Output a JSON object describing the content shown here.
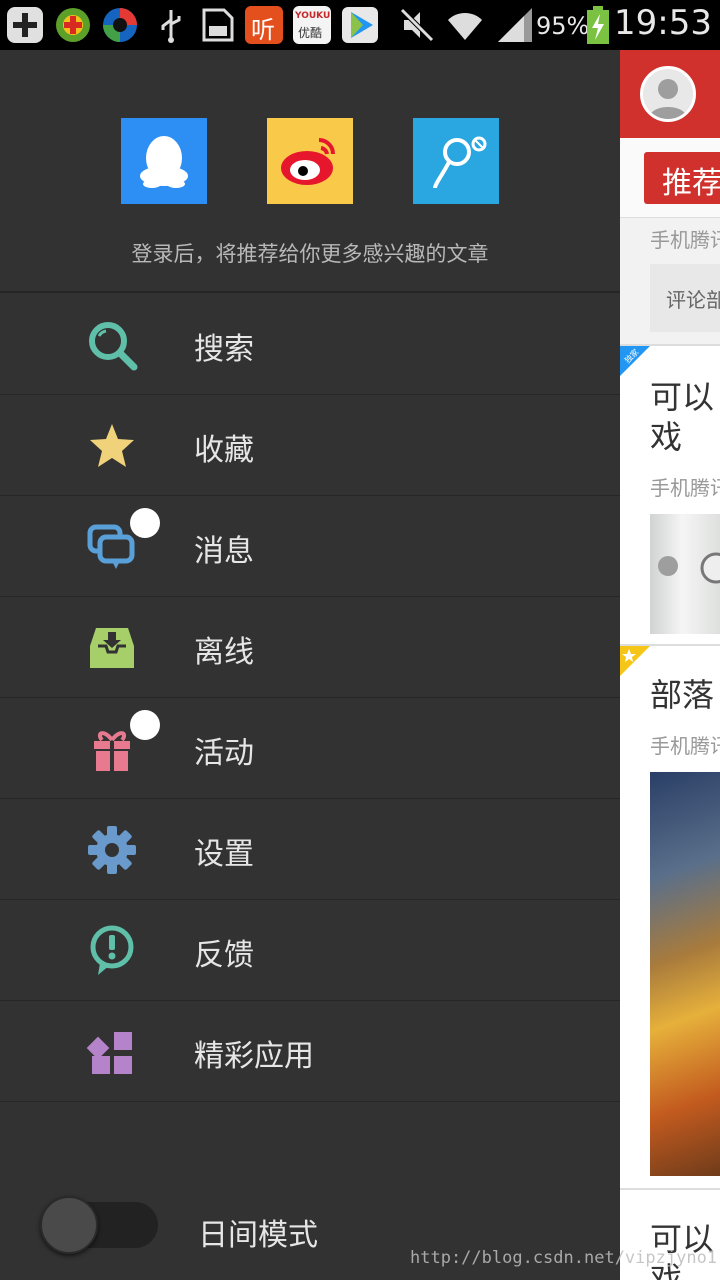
{
  "status_bar": {
    "battery_percent": "95%",
    "time": "19:53",
    "icons": [
      "add-icon",
      "app-icon",
      "app-icon",
      "usb-icon",
      "sd-card-icon",
      "ting-app-icon",
      "youku-app-icon",
      "video-app-icon",
      "mute-icon",
      "wifi-icon",
      "signal-icon",
      "battery-icon"
    ],
    "app_icon_texts": {
      "ting": "听",
      "youku": "YOUKU",
      "youku_cn": "优酷"
    }
  },
  "drawer": {
    "login_hint": "登录后，将推荐给你更多感兴趣的文章",
    "social_logins": [
      {
        "name": "qq-login",
        "color": "#2d8ef4"
      },
      {
        "name": "weibo-login",
        "color": "#f9c949"
      },
      {
        "name": "tencent-weibo-login",
        "color": "#2aa6e0"
      }
    ],
    "menu": [
      {
        "label": "搜索",
        "icon": "search-icon",
        "color": "#5fbfa8",
        "badge": false
      },
      {
        "label": "收藏",
        "icon": "star-icon",
        "color": "#f0d27a",
        "badge": false
      },
      {
        "label": "消息",
        "icon": "message-icon",
        "color": "#5aa0d8",
        "badge": true
      },
      {
        "label": "离线",
        "icon": "offline-download-icon",
        "color": "#a6cf6a",
        "badge": false
      },
      {
        "label": "活动",
        "icon": "gift-icon",
        "color": "#e87a90",
        "badge": true
      },
      {
        "label": "设置",
        "icon": "gear-icon",
        "color": "#6a9acb",
        "badge": false
      },
      {
        "label": "反馈",
        "icon": "feedback-icon",
        "color": "#5fbfa8",
        "badge": false
      },
      {
        "label": "精彩应用",
        "icon": "apps-icon",
        "color": "#b483c9",
        "badge": false
      }
    ],
    "day_mode": {
      "label": "日间模式",
      "enabled": false
    }
  },
  "content": {
    "tab": "推荐",
    "source_1": "手机腾讯",
    "comment": "评论部",
    "article_1_title_line1": "可以",
    "article_1_title_line2": "戏",
    "article_1_tag": "独家",
    "source_2": "手机腾讯",
    "article_2_title": "部落",
    "source_3": "手机腾讯",
    "article_3_title_line1": "可以",
    "article_3_title_line2": "戏"
  },
  "watermark": "http://blog.csdn.net/vipzjyno1"
}
